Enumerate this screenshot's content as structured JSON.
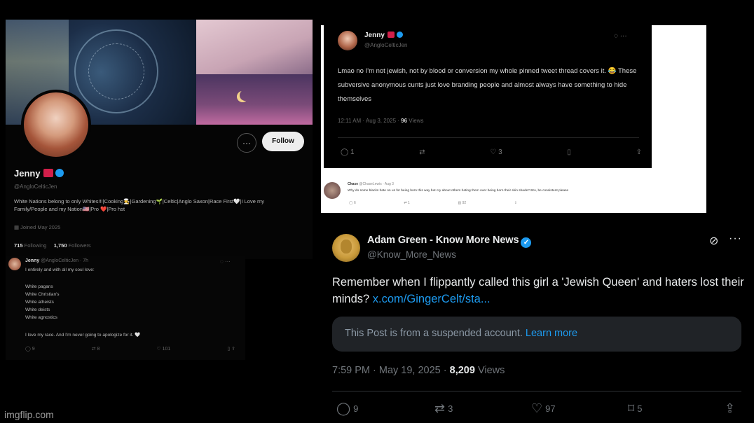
{
  "profile": {
    "name": "Jenny",
    "handle": "@AngloCelticJen",
    "bio": "White Nations belong to only Whites!!!|Cooking🧑‍🍳|Gardening🌱|Celtic|Anglo Saxon|Race First🤍|I Love my Family/People and my Nation🇺🇸|Pro ❤️|Pro hst",
    "joined": "Joined May 2025",
    "following_count": "715",
    "following_label": "Following",
    "followers_count": "1,750",
    "followers_label": "Followers",
    "more_icon": "more-icon",
    "follow_label": "Follow"
  },
  "mini_tweet": {
    "name": "Jenny",
    "handle": "@AngloCelticJen · 7h",
    "lines": [
      "I entirely and with all my soul love:",
      "",
      "White pagans",
      "White Christian's",
      "White atheists",
      "White deists",
      "White agnostics",
      "",
      "I love my race. And I'm never going to apologize for it. 🤍"
    ],
    "actions": [
      "9",
      "8",
      "101",
      "",
      ""
    ]
  },
  "quoted_screenshot": {
    "name": "Jenny",
    "handle": "@AngloCelticJen",
    "text": "Lmao no I'm not jewish, not by blood or conversion my whole pinned tweet thread covers it. 😂 These subversive anonymous cunts just love branding people and almost always have something to hide themselves",
    "time": "12:11 AM · Aug 3, 2025 ·",
    "views": "96",
    "views_label": "Views",
    "actions": [
      "1",
      "",
      "3",
      "",
      ""
    ],
    "reply": {
      "name": "Chase",
      "handle": "@ChaseLewis · Aug 3",
      "text": "Why do some blacks hate on us for being born this way but cry about others hating them over being born their skin shade? Bro, be consistent please",
      "actions": [
        "6",
        "1",
        "92",
        ""
      ]
    }
  },
  "main_tweet": {
    "author_name": "Adam Green - Know More News",
    "author_handle": "@Know_More_News",
    "text": "Remember when I flippantly called this girl a 'Jewish Queen' and haters lost their minds?",
    "link": "x.com/GingerCelt/sta...",
    "suspended_text": "This Post is from a suspended account.",
    "learn_more": "Learn more",
    "timestamp": "7:59 PM · May 19, 2025 ·",
    "views": "8,209",
    "views_label": "Views",
    "replies": "9",
    "reposts": "3",
    "likes": "97",
    "bookmarks": "5"
  },
  "watermark": "imgflip.com",
  "colors": {
    "accent": "#1d9bf0",
    "bg": "#000000",
    "card": "#202327",
    "muted": "#71767b"
  }
}
